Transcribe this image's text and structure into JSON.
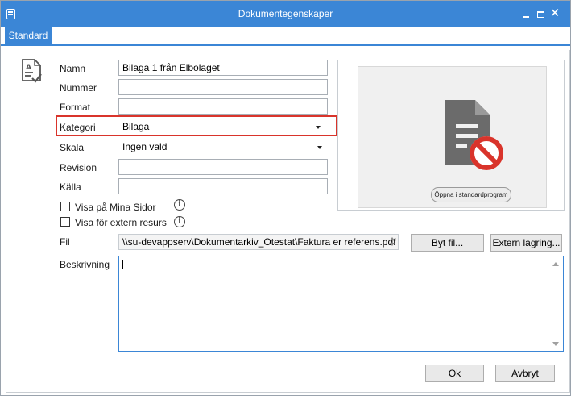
{
  "window": {
    "title": "Dokumentegenskaper",
    "accent": "#3b86d6"
  },
  "tabs": [
    {
      "label": "Standard",
      "active": true
    }
  ],
  "form": {
    "name_label": "Namn",
    "name_value": "Bilaga 1 från Elbolaget",
    "number_label": "Nummer",
    "number_value": "",
    "format_label": "Format",
    "format_value": "",
    "category_label": "Kategori",
    "category_value": "Bilaga",
    "scale_label": "Skala",
    "scale_value": "Ingen vald",
    "revision_label": "Revision",
    "revision_value": "",
    "source_label": "Källa",
    "source_value": "",
    "show_my_pages_label": "Visa på Mina Sidor",
    "show_my_pages_checked": false,
    "show_external_label": "Visa för extern resurs",
    "show_external_checked": false,
    "file_label": "Fil",
    "file_value": "\\\\su-devappserv\\Dokumentarkiv_Otestat\\Faktura er referens.pdf",
    "change_file_button": "Byt fil...",
    "external_storage_button": "Extern lagring...",
    "description_label": "Beskrivning",
    "description_value": ""
  },
  "preview": {
    "icon": "document-blocked-icon",
    "open_button": "Öppna i standardprogram",
    "blocked_color": "#d9342b"
  },
  "footer": {
    "ok_button": "Ok",
    "cancel_button": "Avbryt"
  },
  "highlight_color": "#d9342b"
}
